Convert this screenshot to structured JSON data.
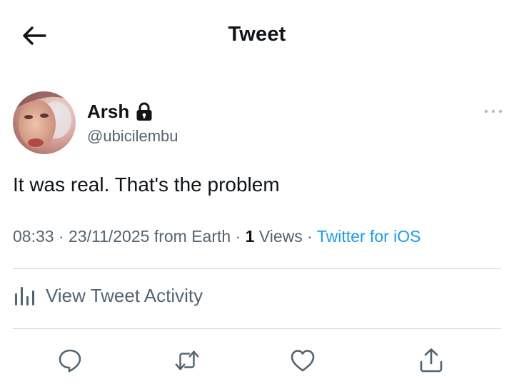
{
  "header": {
    "title": "Tweet",
    "back_icon": "arrow-left-icon"
  },
  "tweet": {
    "author": {
      "display_name": "Arsh",
      "handle": "@ubicilembu",
      "protected_icon": "lock-icon"
    },
    "more_icon": "more-horizontal-icon",
    "text": "It was real. That's the problem",
    "time": "08:33",
    "date": "23/11/2025",
    "location": "from Earth",
    "views_count": "1",
    "views_label": "Views",
    "client": "Twitter for iOS",
    "separator": "·"
  },
  "activity": {
    "label": "View Tweet Activity",
    "icon": "bar-chart-icon"
  },
  "actions": {
    "reply_icon": "reply-icon",
    "retweet_icon": "retweet-icon",
    "like_icon": "like-icon",
    "share_icon": "share-icon"
  },
  "colors": {
    "text": "#0f1419",
    "secondary": "#536471",
    "link": "#1d9bf0",
    "divider": "#cfd9de"
  }
}
